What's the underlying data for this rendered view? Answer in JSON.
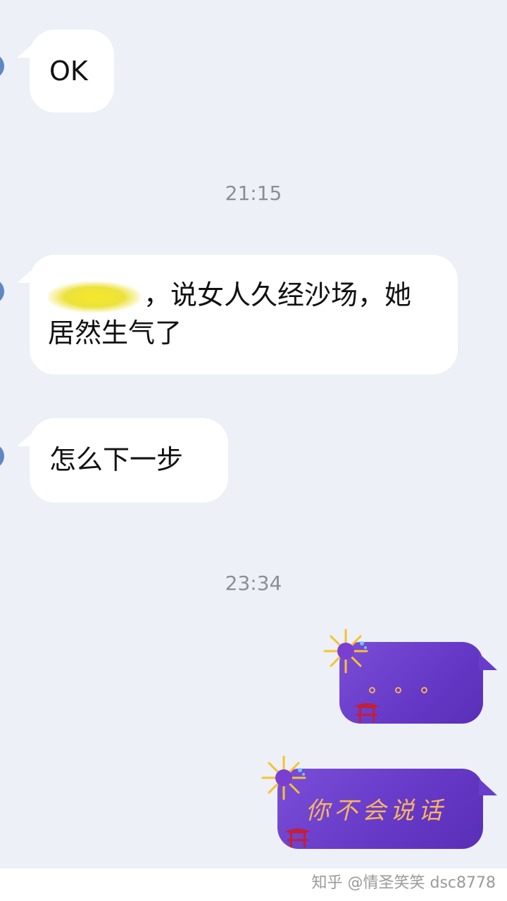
{
  "messages": [
    {
      "direction": "incoming",
      "text": "OK"
    },
    {
      "direction": "incoming",
      "text": "，说女人久经沙场，她居然生气了",
      "line1": "，说女人久经沙场，她",
      "line2": "居然生气了"
    },
    {
      "direction": "incoming",
      "text": "怎么下一步"
    },
    {
      "direction": "outgoing",
      "text": "。 。 。"
    },
    {
      "direction": "outgoing",
      "text": "你不会说话"
    }
  ],
  "timestamps": [
    "21:15",
    "23:34"
  ],
  "watermark": "知乎 @情圣笑笑 dsc8778",
  "colors": {
    "background": "#edf0f6",
    "incoming_bubble": "#ffffff",
    "outgoing_bubble": "#6a3ccb",
    "outgoing_text": "#f6b562"
  },
  "icons": [
    "firework-icon",
    "pavilion-icon"
  ]
}
